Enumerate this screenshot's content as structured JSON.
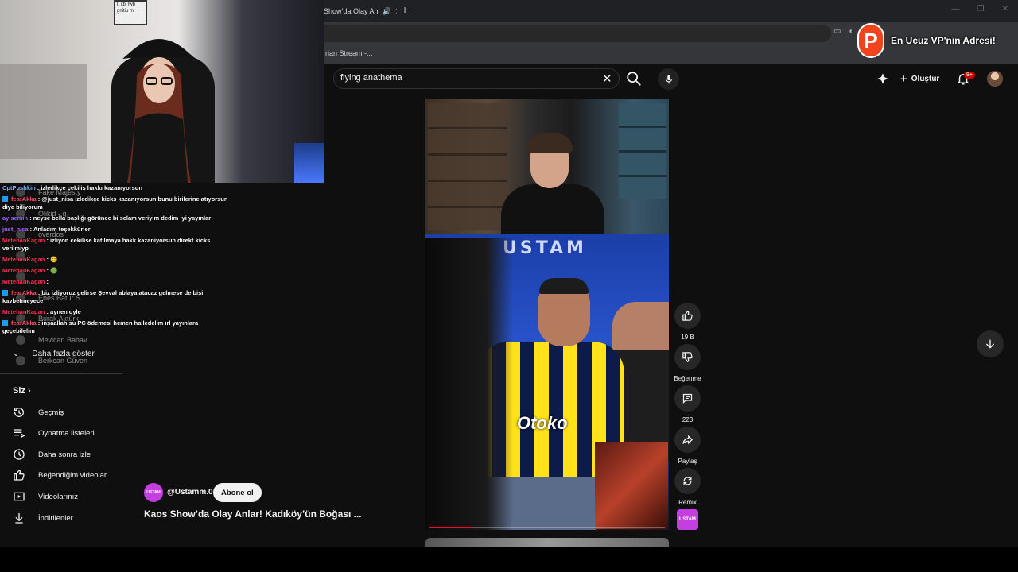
{
  "browser": {
    "tab_title": "Show’da Olay An",
    "bookmark": "rian Stream -..."
  },
  "overlay": {
    "vpn_logo": "P",
    "vpn_text": "En Ucuz VP'nin Adresi!"
  },
  "search": {
    "value": "flying anathema"
  },
  "topbar": {
    "create_label": "Oluştur",
    "notif_count": "9+"
  },
  "webcam": {
    "frame_text": "ti itbi lwb gnitiu mi"
  },
  "chat": {
    "lines": [
      {
        "user": "CptPushkin",
        "msg": ": izledikçe çekiliş hakkı kazanıyorsun",
        "color": "#7bb6ff",
        "tw": false
      },
      {
        "user": "fearAkka",
        "msg": ": @just_nisa izledikçe kicks kazanıyorsun bunu birilerine atıyorsun diye biliyorum",
        "color": "#ff4d6d",
        "tw": true
      },
      {
        "user": "ayisemih",
        "msg": ": neyse bella başlığı görünce bi selam veriyim dedim iyi yayınlar",
        "color": "#9b6bff",
        "tw": false
      },
      {
        "user": "just_nisa",
        "msg": ": Anladım teşekkürler",
        "color": "#b266ff",
        "tw": false
      },
      {
        "user": "MetehanKagan",
        "msg": ": izliyon cekilise katilmaya hakk kazaniyorsun direkt kicks verilmiyp",
        "color": "#ff3355",
        "tw": false
      },
      {
        "user": "MetehanKagan",
        "msg": ": 😊",
        "color": "#ff3355",
        "tw": false
      },
      {
        "user": "MetehanKagan",
        "msg": ": 🟢",
        "color": "#ff3355",
        "tw": false
      },
      {
        "user": "MetehanKagan",
        "msg": ":",
        "color": "#ff3355",
        "tw": false
      },
      {
        "user": "fearAkka",
        "msg": ": biz izliyoruz gelirse Şevval ablaya atacaz gelmese de bişi kaybetmeyece",
        "color": "#ff4d6d",
        "tw": true
      },
      {
        "user": "MetehanKagan",
        "msg": ": aynen oyle",
        "color": "#ff3355",
        "tw": false
      },
      {
        "user": "fearAkka",
        "msg": ": inşaallah su PC ödemesi hemen halledelim ırl yayınlara geçebilelim",
        "color": "#ff4d6d",
        "tw": true
      }
    ]
  },
  "sidebar": {
    "ghost_subs": [
      "Fake Majesty",
      "Olikid - g",
      "overdos",
      "",
      "",
      "Enes Batur S",
      "Burak Aktürk",
      "Mevlcan Bahav",
      "Berkcan Güven"
    ],
    "show_more": "Daha fazla göster",
    "section_title": "Siz",
    "items": [
      {
        "label": "Geçmiş",
        "icon": "history-icon"
      },
      {
        "label": "Oynatma listeleri",
        "icon": "playlists-icon"
      },
      {
        "label": "Daha sonra izle",
        "icon": "watch-later-icon"
      },
      {
        "label": "Beğendiğim videolar",
        "icon": "liked-icon"
      },
      {
        "label": "Videolarınız",
        "icon": "your-videos-icon"
      },
      {
        "label": "İndirilenler",
        "icon": "downloads-icon"
      }
    ]
  },
  "video": {
    "overlay_title": "USTAM",
    "jersey_text": "Otoko",
    "progress_fraction": 0.18,
    "channel_handle": "@Ustamm.0",
    "channel_avatar_text": "USTAM",
    "subscribe_label": "Abone ol",
    "title": "Kaos Show’da Olay Anlar! Kadıköy’ün Boğası ..."
  },
  "actions": {
    "like_count": "19 B",
    "dislike_label": "Beğenme",
    "comment_count": "223",
    "share_label": "Paylaş",
    "remix_label": "Remix"
  },
  "colors": {
    "bg": "#0f0f0f",
    "accent_red": "#ff0033",
    "channel_purple": "#c33fe0"
  }
}
